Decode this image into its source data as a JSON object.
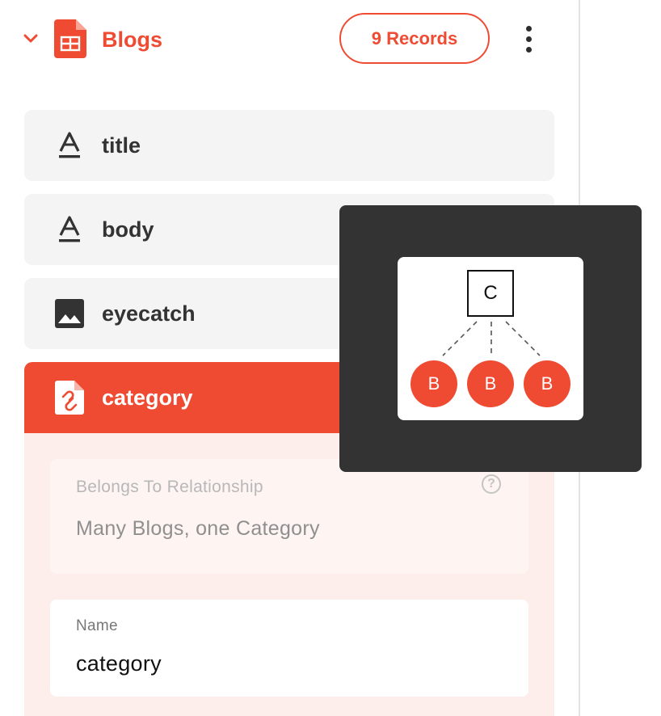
{
  "colors": {
    "accent": "#ef4b33",
    "accent_light": "#fdeeeb",
    "row_bg": "#f4f4f4",
    "tooltip_bg": "#333333",
    "text_dark": "#333333"
  },
  "model": {
    "name": "Blogs",
    "records_label": "9 Records",
    "icon": "table-icon",
    "expand_icon": "chevron-down-icon",
    "menu_icon": "kebab-menu-icon"
  },
  "fields": [
    {
      "label": "title",
      "icon": "text-field-icon"
    },
    {
      "label": "body",
      "icon": "text-field-icon"
    },
    {
      "label": "eyecatch",
      "icon": "image-field-icon"
    },
    {
      "label": "category",
      "icon": "relation-link-icon",
      "selected": true
    }
  ],
  "relationship": {
    "type_label": "Belongs To Relationship",
    "description": "Many Blogs, one Category",
    "help_icon": "help-icon"
  },
  "name_field": {
    "label": "Name",
    "value": "category"
  },
  "tooltip": {
    "parent_node": "C",
    "child_nodes": [
      "B",
      "B",
      "B"
    ]
  }
}
